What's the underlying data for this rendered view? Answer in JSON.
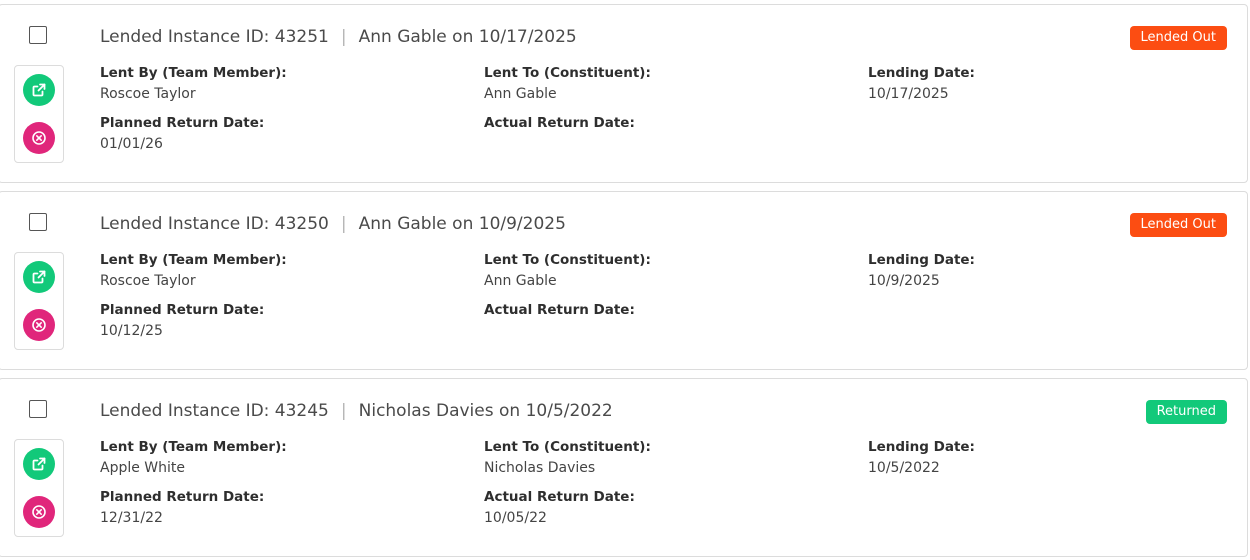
{
  "colors": {
    "lended_out": "#fc4d12",
    "returned": "#12c97a",
    "open_button": "#12c97a",
    "remove_button": "#e0267b"
  },
  "icons": {
    "open": "external-link-icon",
    "remove": "circle-x-icon"
  },
  "labels": {
    "lent_by": "Lent By (Team Member):",
    "lent_to": "Lent To (Constituent):",
    "lending_date": "Lending Date:",
    "planned_return": "Planned Return Date:",
    "actual_return": "Actual Return Date:"
  },
  "records": [
    {
      "id_label": "Lended Instance ID: 43251",
      "summary": "Ann Gable on 10/17/2025",
      "status": "Lended Out",
      "status_key": "lended_out",
      "lent_by": "Roscoe Taylor",
      "lent_to": "Ann Gable",
      "lending_date": "10/17/2025",
      "planned_return": "01/01/26",
      "actual_return": ""
    },
    {
      "id_label": "Lended Instance ID: 43250",
      "summary": "Ann Gable on 10/9/2025",
      "status": "Lended Out",
      "status_key": "lended_out",
      "lent_by": "Roscoe Taylor",
      "lent_to": "Ann Gable",
      "lending_date": "10/9/2025",
      "planned_return": "10/12/25",
      "actual_return": ""
    },
    {
      "id_label": "Lended Instance ID: 43245",
      "summary": "Nicholas Davies on 10/5/2022",
      "status": "Returned",
      "status_key": "returned",
      "lent_by": "Apple White",
      "lent_to": "Nicholas Davies",
      "lending_date": "10/5/2022",
      "planned_return": "12/31/22",
      "actual_return": "10/05/22"
    }
  ]
}
